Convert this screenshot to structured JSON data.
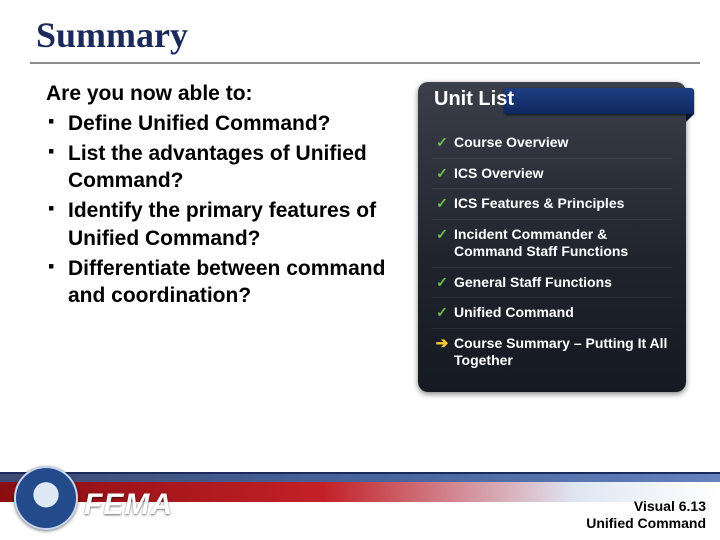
{
  "title": "Summary",
  "lead": "Are you now able to:",
  "bullets": [
    "Define Unified Command?",
    "List the advantages of Unified Command?",
    "Identify the primary features of Unified Command?",
    "Differentiate between command and coordination?"
  ],
  "panel": {
    "title": "Unit List",
    "items": [
      {
        "marker": "check",
        "label": "Course Overview"
      },
      {
        "marker": "check",
        "label": "ICS Overview"
      },
      {
        "marker": "check",
        "label": "ICS Features & Principles"
      },
      {
        "marker": "check",
        "label": "Incident Commander & Command Staff Functions"
      },
      {
        "marker": "check",
        "label": "General Staff Functions"
      },
      {
        "marker": "check",
        "label": "Unified Command"
      },
      {
        "marker": "arrow",
        "label": "Course Summary – Putting It All Together"
      }
    ]
  },
  "footer": {
    "agency": "FEMA",
    "visual_label": "Visual 6.13",
    "unit_label": "Unified Command"
  },
  "glyphs": {
    "check": "✓",
    "arrow": "➔",
    "square": "▪"
  }
}
